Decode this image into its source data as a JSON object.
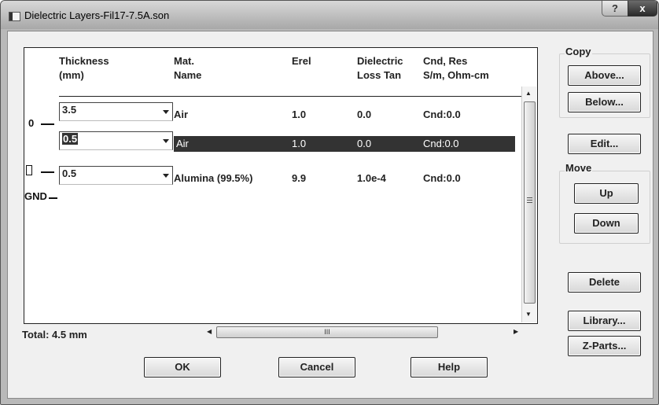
{
  "window": {
    "title": "Dielectric Layers-Fil17-7.5A.son",
    "help_label": "?",
    "close_label": "x"
  },
  "table": {
    "headers": {
      "thickness": "Thickness\n(mm)",
      "material": "Mat.\nName",
      "erel": "Erel",
      "loss": "Dielectric\nLoss Tan",
      "cnd": "Cnd, Res\nS/m, Ohm-cm"
    },
    "rows": [
      {
        "thickness": "3.5",
        "material": "Air",
        "erel": "1.0",
        "loss": "0.0",
        "cnd": "Cnd:0.0",
        "selected": false
      },
      {
        "thickness": "0.5",
        "material": "Air",
        "erel": "1.0",
        "loss": "0.0",
        "cnd": "Cnd:0.0",
        "selected": true
      },
      {
        "thickness": "0.5",
        "material": "Alumina (99.5%)",
        "erel": "9.9",
        "loss": "1.0e-4",
        "cnd": "Cnd:0.0",
        "selected": false
      }
    ],
    "interfaces": [
      "0",
      "1",
      "GND"
    ]
  },
  "total_label": "Total: 4.5 mm",
  "scrollbar": {
    "h_grip": "III",
    "v_grip": "≡"
  },
  "sidebar": {
    "copy_group": "Copy",
    "above_button": "Above...",
    "below_button": "Below...",
    "edit_button": "Edit...",
    "move_group": "Move",
    "up_button": "Up",
    "down_button": "Down",
    "delete_button": "Delete",
    "library_button": "Library...",
    "zparts_button": "Z-Parts..."
  },
  "footer": {
    "ok_button": "OK",
    "cancel_button": "Cancel",
    "help_button": "Help"
  },
  "icons": {
    "title": "window-app-icon",
    "dropdown": "chevron-down-icon",
    "scroll_up": "arrow-up-icon",
    "scroll_down": "arrow-down-icon",
    "scroll_left": "arrow-left-icon",
    "scroll_right": "arrow-right-icon"
  }
}
